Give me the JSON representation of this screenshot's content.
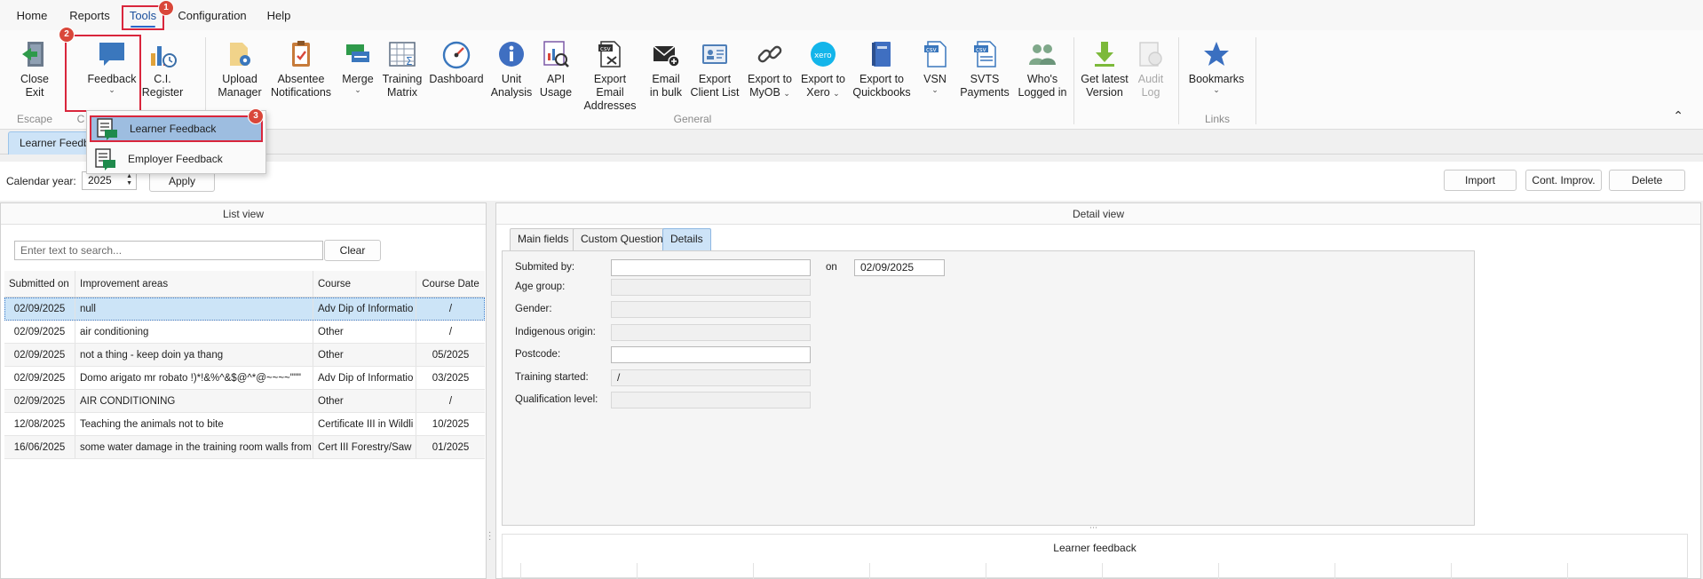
{
  "menu": {
    "items": [
      "Home",
      "Reports",
      "Tools",
      "Configuration",
      "Help"
    ]
  },
  "ribbon": {
    "buttons": {
      "close": [
        "Close",
        "Exit"
      ],
      "feedback": "Feedback",
      "ci_register": [
        "C.I.",
        "Register"
      ],
      "upload_manager": [
        "Upload",
        "Manager"
      ],
      "absentee": [
        "Absentee",
        "Notifications"
      ],
      "merge": "Merge",
      "training_matrix": [
        "Training",
        "Matrix"
      ],
      "dashboard": "Dashboard",
      "unit_analysis": [
        "Unit",
        "Analysis"
      ],
      "api_usage": [
        "API",
        "Usage"
      ],
      "export_email": [
        "Export Email",
        "Addresses"
      ],
      "email_bulk": [
        "Email",
        "in bulk"
      ],
      "export_client": [
        "Export",
        "Client List"
      ],
      "export_myob": [
        "Export to",
        "MyOB"
      ],
      "export_xero": [
        "Export to",
        "Xero"
      ],
      "export_qb": [
        "Export to",
        "Quickbooks"
      ],
      "vsn": "VSN",
      "svts": [
        "SVTS",
        "Payments"
      ],
      "whos_logged": [
        "Who's",
        "Logged in"
      ],
      "latest_version": [
        "Get latest",
        "Version"
      ],
      "audit_log": [
        "Audit",
        "Log"
      ],
      "bookmarks": "Bookmarks"
    },
    "icon_text": {
      "csv": "csv",
      "xero": "xero"
    },
    "groups": {
      "escape": "Escape",
      "ci_partial": "C",
      "general": "General",
      "links": "Links"
    }
  },
  "dropdown": {
    "items": [
      "Learner Feedback",
      "Employer Feedback"
    ]
  },
  "doc_tab": "Learner Feedback",
  "toolbar": {
    "calendar_label": "Calendar year:",
    "calendar_value": "2025",
    "apply": "Apply",
    "import": "Import",
    "cont_improv": "Cont. Improv.",
    "delete": "Delete"
  },
  "list_view": {
    "title": "List view",
    "search_placeholder": "Enter text to search...",
    "clear": "Clear",
    "columns": [
      "Submitted on",
      "Improvement areas",
      "Course",
      "Course Date"
    ],
    "rows": [
      [
        "02/09/2025",
        "null",
        "Adv Dip of Informatio",
        "/"
      ],
      [
        "02/09/2025",
        "air conditioning",
        "Other",
        "/"
      ],
      [
        "02/09/2025",
        "not a thing - keep doin ya thang",
        "Other",
        "05/2025"
      ],
      [
        "02/09/2025",
        "Domo arigato mr robato !)*!&%^&$@^*@~~~~\"\"\"",
        "Adv Dip of Informatio",
        "03/2025"
      ],
      [
        "02/09/2025",
        "AIR CONDITIONING",
        "Other",
        "/"
      ],
      [
        "12/08/2025",
        "Teaching the animals not to bite",
        "Certificate III in Wildli",
        "10/2025"
      ],
      [
        "16/06/2025",
        "some water damage in the training room walls from",
        "Cert III Forestry/Saw",
        "01/2025"
      ]
    ]
  },
  "detail_view": {
    "title": "Detail view",
    "tabs": [
      "Main fields",
      "Custom Questions",
      "Details"
    ],
    "fields": {
      "submitted_by": "Submited by:",
      "on": "on",
      "date": "02/09/2025",
      "age_group": "Age group:",
      "gender": "Gender:",
      "indigenous": "Indigenous origin:",
      "postcode": "Postcode:",
      "training_started": "Training started:",
      "training_started_value": "/",
      "qualification": "Qualification level:"
    },
    "chart_title": "Learner feedback"
  },
  "badges": [
    "1",
    "2",
    "3"
  ],
  "colors": {
    "accent": "#2a66c9",
    "highlight_red": "#d9263c",
    "selected_row": "#cce4f7"
  }
}
